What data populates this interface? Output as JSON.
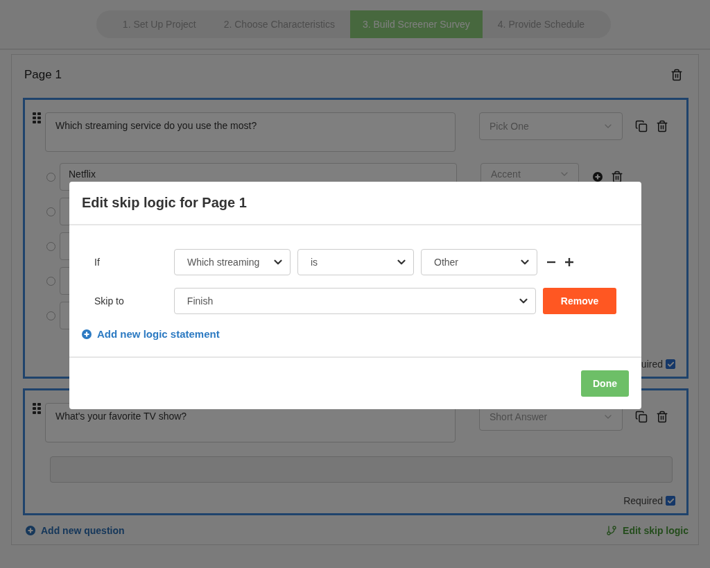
{
  "steps": [
    {
      "label": "1. Set Up Project",
      "selected": false
    },
    {
      "label": "2. Choose Characteristics",
      "selected": false
    },
    {
      "label": "3. Build Screener Survey",
      "selected": true
    },
    {
      "label": "4. Provide Schedule",
      "selected": false
    }
  ],
  "page": {
    "title": "Page 1",
    "questions": [
      {
        "kind": "choice",
        "text": "Which streaming service do you use the most?",
        "type": "Pick One",
        "options": [
          {
            "label": "Netflix",
            "answer_type": "Accent",
            "selected": false
          },
          {
            "selected": false
          },
          {
            "selected": false
          },
          {
            "selected": false
          },
          {
            "selected": false
          }
        ],
        "required_label": "uired",
        "required": true
      },
      {
        "kind": "short",
        "text": "What's your favorite TV show?",
        "type": "Short Answer",
        "required_label": "Required",
        "required": true
      }
    ],
    "add_question": "Add new question",
    "edit_skip_logic": "Edit skip logic"
  },
  "modal": {
    "title": "Edit skip logic for Page 1",
    "condition": {
      "label": "If",
      "fields": [
        "Which streaming",
        "is",
        "Other"
      ]
    },
    "target": {
      "label": "Skip to",
      "value": "Finish",
      "button": "Remove"
    },
    "add_statement": "Add new logic statement",
    "done": "Done"
  }
}
